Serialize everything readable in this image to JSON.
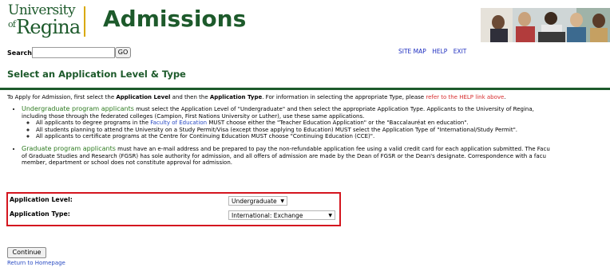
{
  "header": {
    "logo_line1": "University",
    "logo_of": "of",
    "logo_line2": "Regina",
    "title": "Admissions"
  },
  "search": {
    "label": "Search",
    "value": "",
    "placeholder": "",
    "go_label": "GO"
  },
  "toplinks": [
    "SITE MAP",
    "HELP",
    "EXIT"
  ],
  "page": {
    "title": "Select an Application Level & Type",
    "intro_part1": "To Apply for Admission, first select the ",
    "intro_bold1": "Application Level",
    "intro_part2": " and then the ",
    "intro_bold2": "Application Type",
    "intro_part3": ". For information in selecting the appropriate Type, please ",
    "intro_link": "refer to the HELP link above",
    "intro_end": "."
  },
  "bullets": {
    "ug_term": "Undergraduate program applicants",
    "ug_text1": " must select the Application Level of \"Undergraduate\" and then select the appropriate Application Type. Applicants to the University of Regina,",
    "ug_text2": "including those through the federated colleges (Campion, First Nations University or Luther), use these same applications.",
    "sub1_part1": "All applicants to degree programs in the ",
    "sub1_link": "Faculty of Education",
    "sub1_part2": " MUST choose either the \"Teacher Education Application\" or the \"Baccalauréat en education\".",
    "sub2": "All students planning to attend the University on a Study Permit/Visa (except those applying to Education) MUST select the Application Type of \"International/Study Permit\".",
    "sub3": "All applicants to certificate programs at the Centre for Continuing Education MUST choose \"Continuing Education (CCE)\".",
    "grad_term": "Graduate program applicants",
    "grad_text1": " must have an e-mail address and be prepared to pay the non-refundable application fee using a valid credit card for each application submitted. The Facu",
    "grad_text2": "of Graduate Studies and Research (FGSR) has sole authority for admission, and all offers of admission are made by the Dean of FGSR or the Dean's designate. Correspondence with a facu",
    "grad_text3": "member, department or school does not constitute approval for admission."
  },
  "form": {
    "level_label": "Application Level:",
    "level_value": "Undergraduate",
    "type_label": "Application Type:",
    "type_value": "International: Exchange"
  },
  "actions": {
    "continue_label": "Continue",
    "homepage_link": "Return to Homepage"
  },
  "colors": {
    "brand_green": "#1d5a2b",
    "highlight_red": "#d4161f",
    "link_blue": "#2a4bc3"
  }
}
